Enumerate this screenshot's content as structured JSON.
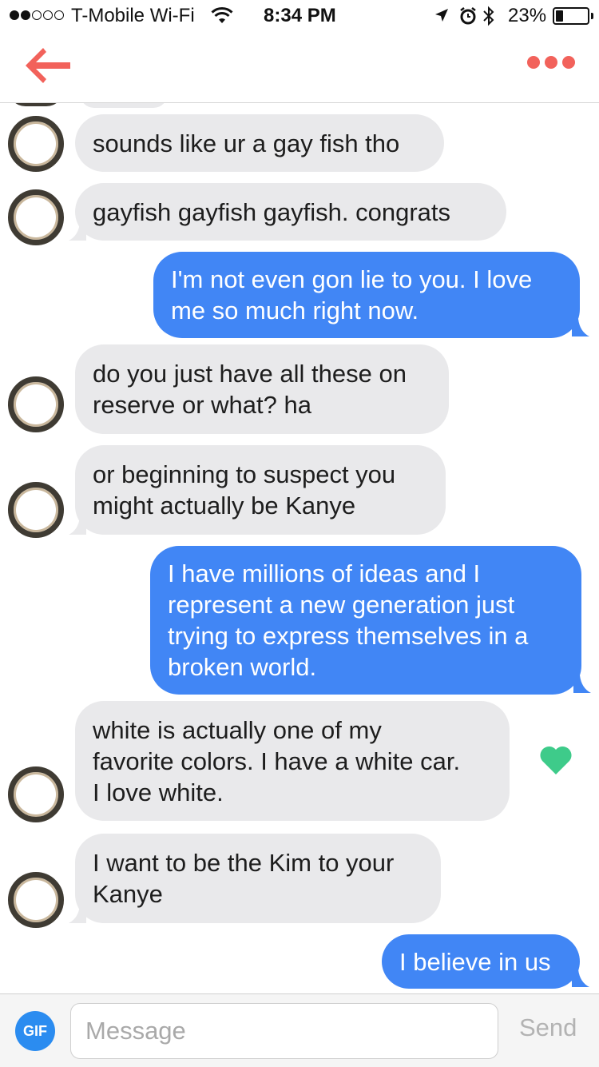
{
  "status_bar": {
    "carrier": "T-Mobile Wi-Fi",
    "time": "8:34 PM",
    "battery_percent": "23%",
    "battery_level": 0.23,
    "signal_bars": 2,
    "icons": [
      "wifi-icon",
      "location-icon",
      "alarm-icon",
      "bluetooth-icon",
      "battery-icon"
    ]
  },
  "nav": {
    "back_icon": "back-arrow-icon",
    "more_icon": "more-dots-icon",
    "accent_color": "#f2625b"
  },
  "colors": {
    "outgoing_bubble": "#4186f5",
    "incoming_bubble": "#e9e9eb",
    "like_heart": "#3ecb8a"
  },
  "messages": [
    {
      "direction": "in",
      "text": "sounds like ur a gay fish tho"
    },
    {
      "direction": "in",
      "text": "gayfish gayfish gayfish. congrats"
    },
    {
      "direction": "out",
      "text": "I'm not even gon lie to you. I love\nme so much right now."
    },
    {
      "direction": "in",
      "text": "do you just have all these on\nreserve or what? ha"
    },
    {
      "direction": "in",
      "text": "or beginning to suspect you\nmight actually be Kanye"
    },
    {
      "direction": "out",
      "text": "I have millions of ideas and I\nrepresent a new generation just\ntrying to express themselves in a\nbroken world."
    },
    {
      "direction": "in",
      "text": "white is actually one of my\nfavorite colors. I have a white car.\nI love white.",
      "liked": true
    },
    {
      "direction": "in",
      "text": "I want to be the Kim to your\nKanye"
    },
    {
      "direction": "out",
      "text": "I believe in us"
    }
  ],
  "input_bar": {
    "gif_label": "GIF",
    "message_placeholder": "Message",
    "send_label": "Send"
  }
}
